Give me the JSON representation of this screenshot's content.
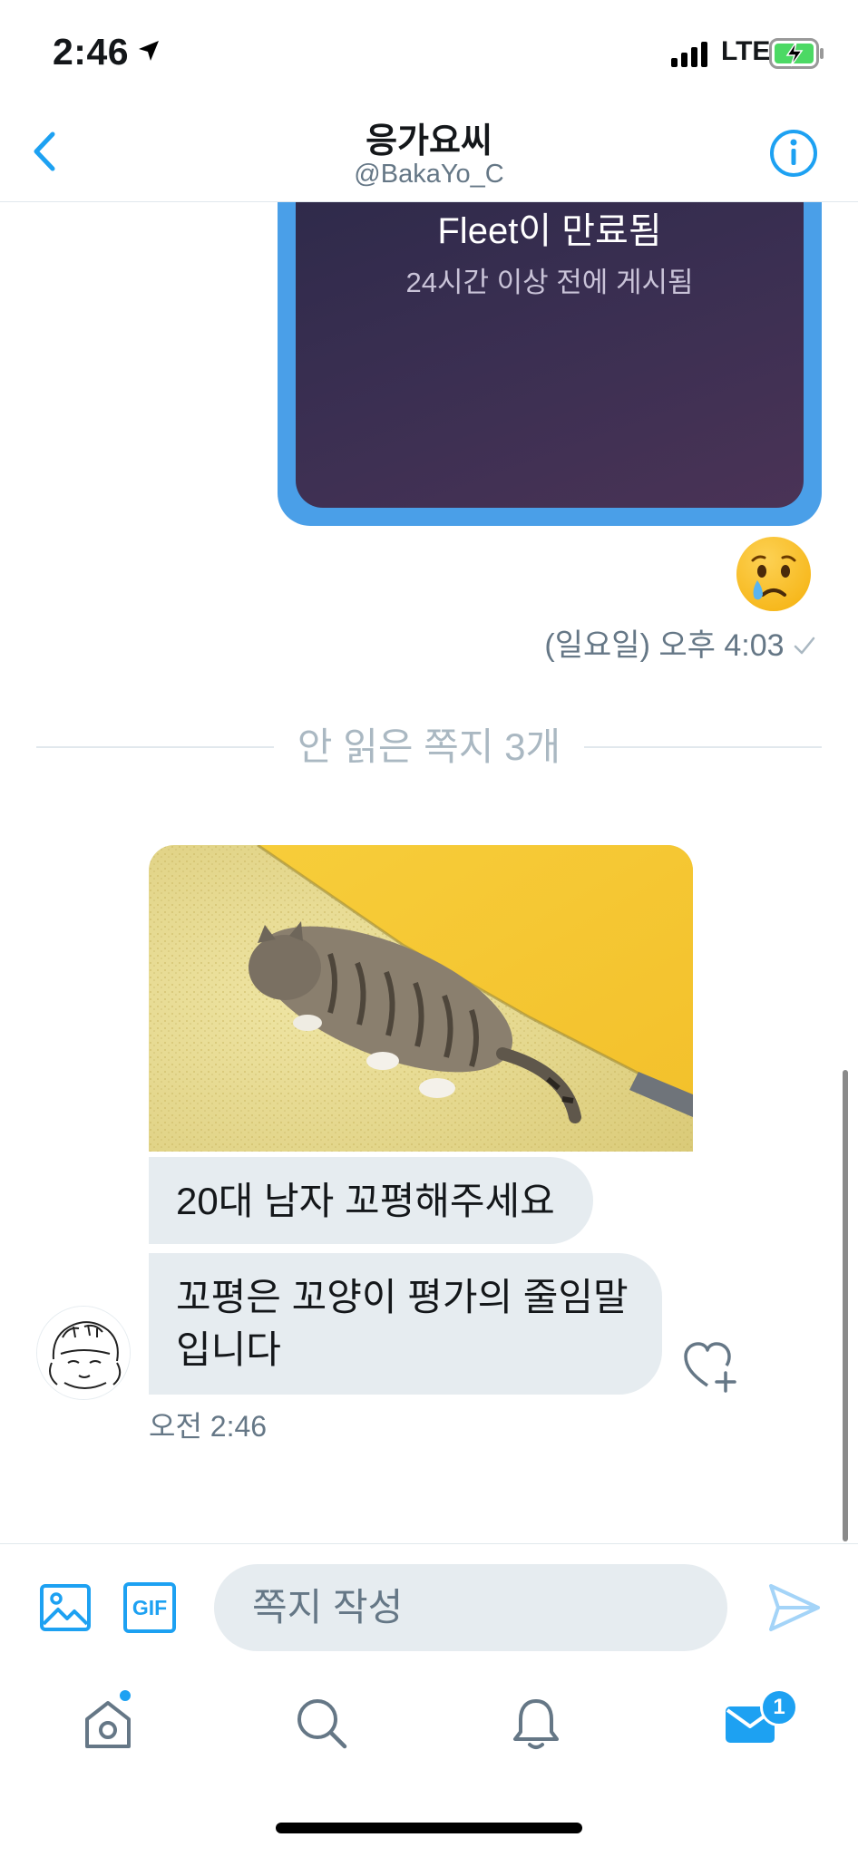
{
  "status_bar": {
    "time": "2:46",
    "network": "LTE"
  },
  "header": {
    "title": "응가요씨",
    "handle": "@BakaYo_C"
  },
  "conversation": {
    "fleet_card": {
      "title": "Fleet이 만료됨",
      "subtitle": "24시간 이상 전에 게시됨"
    },
    "sent_emoji": "crying-face",
    "sent_timestamp": "(일요일) 오후 4:03",
    "unread_divider": "안 읽은 쪽지 3개",
    "received_messages": [
      {
        "type": "image",
        "description": "tabby-cat-photo"
      },
      {
        "type": "text",
        "text": "20대 남자 꼬평해주세요"
      },
      {
        "type": "text",
        "text": "꼬평은 꼬양이 평가의 줄임말 입니다"
      }
    ],
    "received_timestamp": "오전 2:46"
  },
  "composer": {
    "gif_label": "GIF",
    "placeholder": "쪽지 작성"
  },
  "tab_bar": {
    "messages_badge": "1"
  },
  "colors": {
    "accent": "#1da1f2",
    "bubble_bg": "#e6ecf0",
    "secondary_text": "#657786"
  }
}
